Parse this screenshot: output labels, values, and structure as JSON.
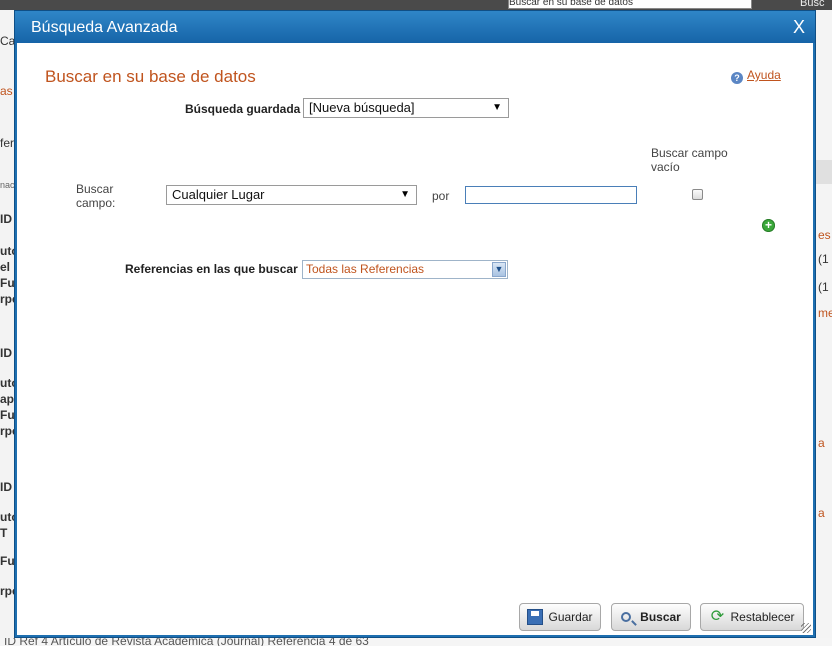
{
  "background": {
    "top_search_text": "Buscar en su base de datos",
    "top_search_label": "Busc",
    "left_fragments": [
      "Ca",
      "as",
      "fer",
      "nac",
      "ID",
      "uto",
      "el",
      "Fu",
      "rpe",
      "ID",
      "uto",
      "ap",
      "Fu",
      "rpe",
      "ID",
      "uto",
      "T",
      "Fu",
      "rpe"
    ],
    "right_fragments": [
      "es",
      "(1",
      "(1",
      "me",
      "a",
      "a"
    ],
    "bottom_text": "ID Ref  4          Artículo de Revista Académica (Journal) Referencia 4 de 63"
  },
  "dialog": {
    "title": "Búsqueda Avanzada",
    "close_label": "X",
    "heading": "Buscar en su base de datos",
    "help_label": "Ayuda",
    "saved_search": {
      "label": "Búsqueda guardada",
      "value": "[Nueva búsqueda]"
    },
    "field": {
      "label_line1": "Buscar",
      "label_line2": "campo:",
      "value": "Cualquier Lugar",
      "por_label": "por",
      "input_value": "",
      "empty_label_line1": "Buscar campo",
      "empty_label_line2": "vacío",
      "empty_checked": false
    },
    "references": {
      "label": "Referencias en las que buscar",
      "value": "Todas las Referencias"
    },
    "buttons": {
      "save": "Guardar",
      "search": "Buscar",
      "reset": "Restablecer"
    }
  },
  "colors": {
    "titlebar": "#1e6fb0",
    "accent_orange": "#c0541e",
    "add_green": "#3aa83a"
  },
  "icons": {
    "close": "close-icon",
    "help": "help-icon",
    "add": "plus-circle-icon",
    "save": "floppy-disk-icon",
    "search": "magnifier-icon",
    "reset": "refresh-icon"
  }
}
